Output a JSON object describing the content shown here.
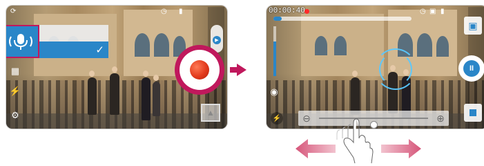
{
  "left_screen": {
    "mode_menu": {
      "selected_icon": "microphone-icon",
      "check_icon": "check-icon"
    },
    "rail_icons": [
      "camera-switch-icon",
      "picture-size-icon",
      "flash-off-icon",
      "settings-icon"
    ],
    "status_icons": [
      "timer-icon",
      "battery-icon"
    ],
    "record_button": "record-icon",
    "camera_mode_icon": "video-camera-icon",
    "gallery_icon": "gallery-thumbnail-icon"
  },
  "transition_arrow": "right-arrow-icon",
  "right_screen": {
    "timer": "00:00:40",
    "recording_indicator": "red-dot",
    "status_icons": [
      "timer-icon",
      "memory-icon",
      "battery-icon"
    ],
    "capture_icon": "capture-icon",
    "pause_icon": "pause-icon",
    "stop_icon": "stop-icon",
    "zoom_out_icon": "zoom-out-icon",
    "zoom_in_icon": "zoom-in-icon",
    "flash_icon": "flash-off-icon",
    "zoom_level": 0.5,
    "colors": {
      "accent": "#2a86c8",
      "highlight": "#c0185c",
      "record": "#e23a1c"
    }
  },
  "gesture": {
    "hand_icon": "pinch-hand-icon",
    "arrows": [
      "left-drag-arrow-icon",
      "right-drag-arrow-icon"
    ]
  }
}
